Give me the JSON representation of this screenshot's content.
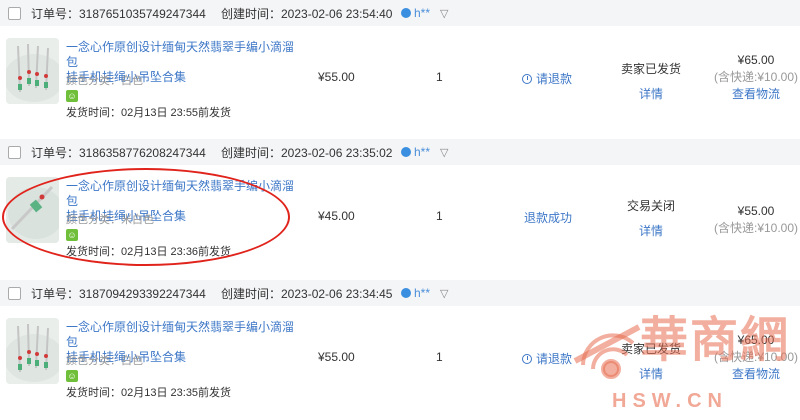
{
  "orders": [
    {
      "order_no": "订单号：3187651035749247344",
      "created": "创建时间：2023-02-06 23:54:40",
      "buyer": "h**",
      "title_line1": "一念心作原创设计缅甸天然翡翠手编小滴溜包",
      "title_line2": "挂手机挂绳小吊坠合集",
      "spec": "颜色分类：白色",
      "ship_time": "发货时间：02月13日 23:55前发货",
      "price": "¥55.00",
      "qty": "1",
      "refund": "请退款",
      "status": "卖家已发货",
      "status_link": "详情",
      "total": "¥65.00",
      "ship_fee": "(含快递:¥10.00)",
      "total_link": "查看物流"
    },
    {
      "order_no": "订单号：3186358776208247344",
      "created": "创建时间：2023-02-06 23:35:02",
      "buyer": "h**",
      "title_line1": "一念心作原创设计缅甸天然翡翠手编小滴溜包",
      "title_line2": "挂手机挂绳小吊坠合集",
      "spec": "颜色分类：米白色",
      "ship_time": "发货时间：02月13日 23:36前发货",
      "price": "¥45.00",
      "qty": "1",
      "refund": "退款成功",
      "status": "交易关闭",
      "status_link": "详情",
      "total": "¥55.00",
      "ship_fee": "(含快递:¥10.00)",
      "total_link": ""
    },
    {
      "order_no": "订单号：3187094293392247344",
      "created": "创建时间：2023-02-06 23:34:45",
      "buyer": "h**",
      "title_line1": "一念心作原创设计缅甸天然翡翠手编小滴溜包",
      "title_line2": "挂手机挂绳小吊坠合集",
      "spec": "颜色分类：白色",
      "ship_time": "发货时间：02月13日 23:35前发货",
      "price": "¥55.00",
      "qty": "1",
      "refund": "请退款",
      "status": "卖家已发货",
      "status_link": "详情",
      "total": "¥65.00",
      "ship_fee": "(含快递:¥10.00)",
      "total_link": "查看物流"
    }
  ],
  "watermark": {
    "text": "華商網",
    "url": "HSW.CN"
  },
  "colors": {
    "link": "#3d77c7",
    "header_bg": "#f4f5f7",
    "annotation": "#e0231b",
    "watermark": "#e86e50"
  },
  "icons": {
    "buyer": "buyer-avatar-icon",
    "filter": "filter-icon",
    "refund": "clock-icon",
    "badge": "service-badge-icon"
  }
}
